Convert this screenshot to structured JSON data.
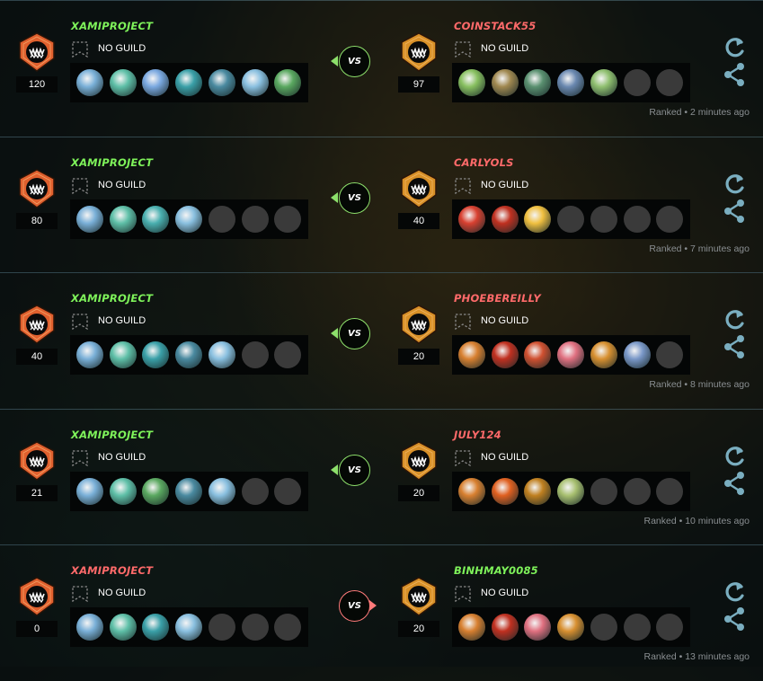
{
  "colors": {
    "winner_name": "#7ef25a",
    "loser_name": "#ff6a6a",
    "vs_win_border": "#8de06b",
    "vs_loss_border": "#ff7a7a",
    "league_left": "#e0602e",
    "league_right": "#d89028",
    "icon_color": "#7aaec0"
  },
  "icons": {
    "league": "league-badge-icon",
    "guild": "guild-banner-icon",
    "replay": "replay-icon",
    "share": "share-icon"
  },
  "battles": [
    {
      "left": {
        "name": "XAMIPROJECT",
        "result": "win",
        "guild": "NO GUILD",
        "rating": "120",
        "team": [
          "#7ab0d8",
          "#5fc0a8",
          "#7aa8e0",
          "#3aa0a8",
          "#4a8aa0",
          "#8ac0e0",
          "#5aa860"
        ]
      },
      "right": {
        "name": "COINSTACK55",
        "result": "loss",
        "guild": "NO GUILD",
        "rating": "97",
        "team": [
          "#88c060",
          "#a08850",
          "#5a9070",
          "#6a88b0",
          "#90c070",
          "",
          ""
        ]
      },
      "vs": "VS",
      "vs_result": "win",
      "time": "Ranked • 2 minutes ago"
    },
    {
      "left": {
        "name": "XAMIPROJECT",
        "result": "win",
        "guild": "NO GUILD",
        "rating": "80",
        "team": [
          "#7ab0d8",
          "#5fc0a8",
          "#4ab0b0",
          "#8ac0e0",
          "",
          "",
          ""
        ]
      },
      "right": {
        "name": "CARLYOLS",
        "result": "loss",
        "guild": "NO GUILD",
        "rating": "40",
        "team": [
          "#d84030",
          "#c03020",
          "#f0c040",
          "",
          "",
          "",
          ""
        ]
      },
      "vs": "VS",
      "vs_result": "win",
      "time": "Ranked • 7 minutes ago"
    },
    {
      "left": {
        "name": "XAMIPROJECT",
        "result": "win",
        "guild": "NO GUILD",
        "rating": "40",
        "team": [
          "#7ab0d8",
          "#5fc0a8",
          "#3aa0a8",
          "#4a8aa0",
          "#8ac0e0",
          "",
          ""
        ]
      },
      "right": {
        "name": "PHOEBEREILLY",
        "result": "loss",
        "guild": "NO GUILD",
        "rating": "20",
        "team": [
          "#d88030",
          "#c03020",
          "#d05030",
          "#e07080",
          "#d89030",
          "#7a98c8",
          ""
        ]
      },
      "vs": "VS",
      "vs_result": "win",
      "time": "Ranked • 8 minutes ago"
    },
    {
      "left": {
        "name": "XAMIPROJECT",
        "result": "win",
        "guild": "NO GUILD",
        "rating": "21",
        "team": [
          "#7ab0d8",
          "#5fc0a8",
          "#5aa860",
          "#4a8aa0",
          "#8ac0e0",
          "",
          ""
        ]
      },
      "right": {
        "name": "JULY124",
        "result": "loss",
        "guild": "NO GUILD",
        "rating": "20",
        "team": [
          "#d88030",
          "#e06020",
          "#c08020",
          "#a8c070",
          "",
          "",
          ""
        ]
      },
      "vs": "VS",
      "vs_result": "win",
      "time": "Ranked • 10 minutes ago"
    },
    {
      "left": {
        "name": "XAMIPROJECT",
        "result": "loss",
        "guild": "NO GUILD",
        "rating": "0",
        "team": [
          "#7ab0d8",
          "#5fc0a8",
          "#3aa0a8",
          "#8ac0e0",
          "",
          "",
          ""
        ]
      },
      "right": {
        "name": "BINHMAY0085",
        "result": "win",
        "guild": "NO GUILD",
        "rating": "20",
        "team": [
          "#d88030",
          "#c03020",
          "#e07080",
          "#d89030",
          "",
          "",
          ""
        ]
      },
      "vs": "VS",
      "vs_result": "loss",
      "time": "Ranked • 13 minutes ago"
    }
  ]
}
